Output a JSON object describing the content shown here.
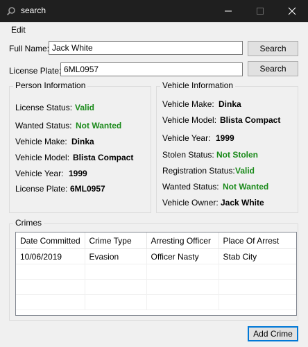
{
  "window": {
    "title": "search"
  },
  "menu": {
    "edit": "Edit"
  },
  "search": {
    "full_name_label": "Full Name:",
    "full_name_value": "Jack White",
    "plate_label": "License Plate:",
    "plate_value": "6ML0957",
    "search_button": "Search"
  },
  "person": {
    "title": "Person Information",
    "rows": [
      {
        "label": "License Status:",
        "value": "Valid"
      },
      {
        "label": "Wanted Status:",
        "value": "Not Wanted"
      },
      {
        "label": "Vehicle Make:",
        "value": "Dinka"
      },
      {
        "label": "Vehicle Model:",
        "value": "Blista Compact"
      },
      {
        "label": "Vehicle Year:",
        "value": "1999"
      },
      {
        "label": "License Plate:",
        "value": "6ML0957"
      }
    ]
  },
  "vehicle": {
    "title": "Vehicle Information",
    "rows": [
      {
        "label": "Vehicle Make:",
        "value": "Dinka"
      },
      {
        "label": "Vehicle Model:",
        "value": "Blista Compact"
      },
      {
        "label": "Vehicle Year:",
        "value": "1999"
      },
      {
        "label": "Stolen Status:",
        "value": "Not Stolen"
      },
      {
        "label": "Registration Status:",
        "value": "Valid"
      },
      {
        "label": "Wanted Status:",
        "value": "Not Wanted"
      },
      {
        "label": "Vehicle Owner:",
        "value": "Jack White"
      }
    ]
  },
  "crimes": {
    "title": "Crimes",
    "columns": [
      "Date Committed",
      "Crime Type",
      "Arresting Officer",
      "Place Of Arrest"
    ],
    "rows": [
      [
        "10/06/2019",
        "Evasion",
        "Officer Nasty",
        "Stab City"
      ]
    ]
  },
  "add_crime_button": "Add Crime",
  "colors": {
    "title_bar": "#1f1f1f",
    "status_green": "#1a8a1a",
    "accent_border": "#0078d7"
  }
}
